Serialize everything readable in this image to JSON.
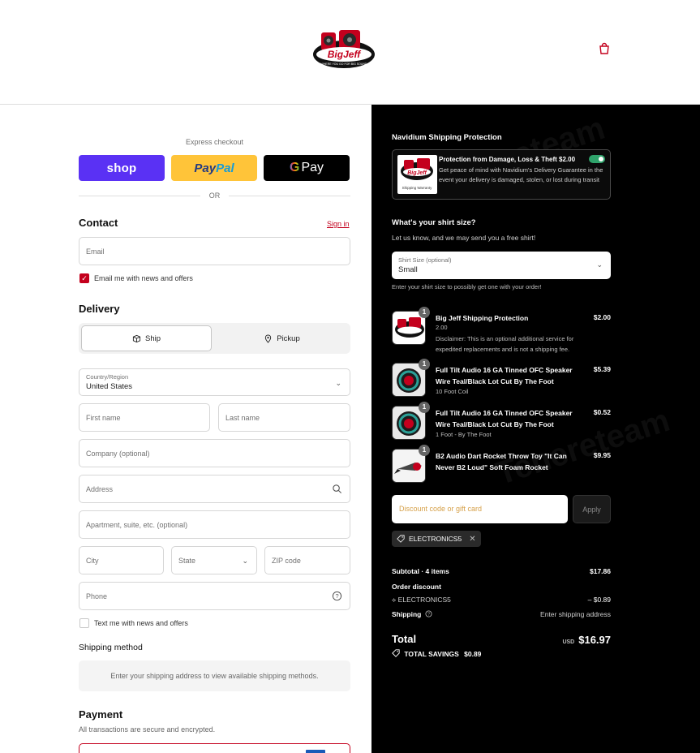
{
  "watermark": "Tenereteam",
  "header": {
    "logo_text": "BigJeff",
    "logo_tagline": "WHERE YOU GO FOR BIG SOUND",
    "cart_icon": "bag-icon"
  },
  "express": {
    "label": "Express checkout",
    "shop_label": "shop",
    "paypal_label_1": "Pay",
    "paypal_label_2": "Pal",
    "gpay_g": "G",
    "gpay_label": "Pay",
    "or_label": "OR"
  },
  "contact": {
    "heading": "Contact",
    "signin_label": "Sign in",
    "email_placeholder": "Email",
    "news_label": "Email me with news and offers",
    "news_checked": true
  },
  "delivery": {
    "heading": "Delivery",
    "ship_label": "Ship",
    "pickup_label": "Pickup",
    "country_label": "Country/Region",
    "country_value": "United States",
    "first_name_placeholder": "First name",
    "last_name_placeholder": "Last name",
    "company_placeholder": "Company (optional)",
    "address_placeholder": "Address",
    "apartment_placeholder": "Apartment, suite, etc. (optional)",
    "city_placeholder": "City",
    "state_placeholder": "State",
    "zip_placeholder": "ZIP code",
    "phone_placeholder": "Phone",
    "sms_label": "Text me with news and offers",
    "sms_checked": false
  },
  "shipping_method": {
    "heading": "Shipping method",
    "message": "Enter your shipping address to view available shipping methods."
  },
  "payment": {
    "heading": "Payment",
    "subtext": "All transactions are secure and encrypted."
  },
  "protection": {
    "heading": "Navidium Shipping Protection",
    "title": "Protection from Damage, Loss & Theft $2.00",
    "description": "Get peace of mind with Navidium's Delivery Guarantee in the event your delivery is damaged, stolen, or lost during transit",
    "thumb_caption": "Shipping Warranty",
    "enabled": true
  },
  "shirt": {
    "heading": "What's your shirt size?",
    "subtext": "Let us know, and we may send you a free shirt!",
    "select_label": "Shirt Size (optional)",
    "select_value": "Small",
    "helper": "Enter your shirt size to possibly get one with your order!"
  },
  "cart": {
    "items": [
      {
        "qty": "1",
        "name": "Big Jeff Shipping Protection",
        "variant": "2.00",
        "note": "Disclaimer: This is an optional additional service for expedited replacements and is not a shipping fee.",
        "price": "$2.00"
      },
      {
        "qty": "1",
        "name": "Full Tilt Audio 16 GA Tinned OFC Speaker Wire Teal/Black Lot Cut By The Foot",
        "variant": "10 Foot Coil",
        "price": "$5.39"
      },
      {
        "qty": "1",
        "name": "Full Tilt Audio 16 GA Tinned OFC Speaker Wire Teal/Black Lot Cut By The Foot",
        "variant": "1 Foot - By The Foot",
        "price": "$0.52"
      },
      {
        "qty": "1",
        "name": "B2 Audio Dart Rocket Throw Toy \"It Can Never B2 Loud\" Soft Foam Rocket",
        "price": "$9.95"
      }
    ]
  },
  "discount": {
    "placeholder": "Discount code or gift card",
    "apply_label": "Apply",
    "applied_code": "ELECTRONICS5"
  },
  "summary": {
    "subtotal_label": "Subtotal · 4 items",
    "subtotal_value": "$17.86",
    "order_discount_label": "Order discount",
    "discount_code": "ELECTRONICS5",
    "discount_value": "– $0.89",
    "shipping_label": "Shipping",
    "shipping_value": "Enter shipping address",
    "total_label": "Total",
    "currency": "USD",
    "total_value": "$16.97",
    "savings_label": "TOTAL SAVINGS",
    "savings_value": "$0.89"
  },
  "colors": {
    "accent": "#c4001d",
    "shop_purple": "#5a31f4",
    "paypal_yellow": "#ffc439",
    "toggle_green": "#2fa36b"
  }
}
